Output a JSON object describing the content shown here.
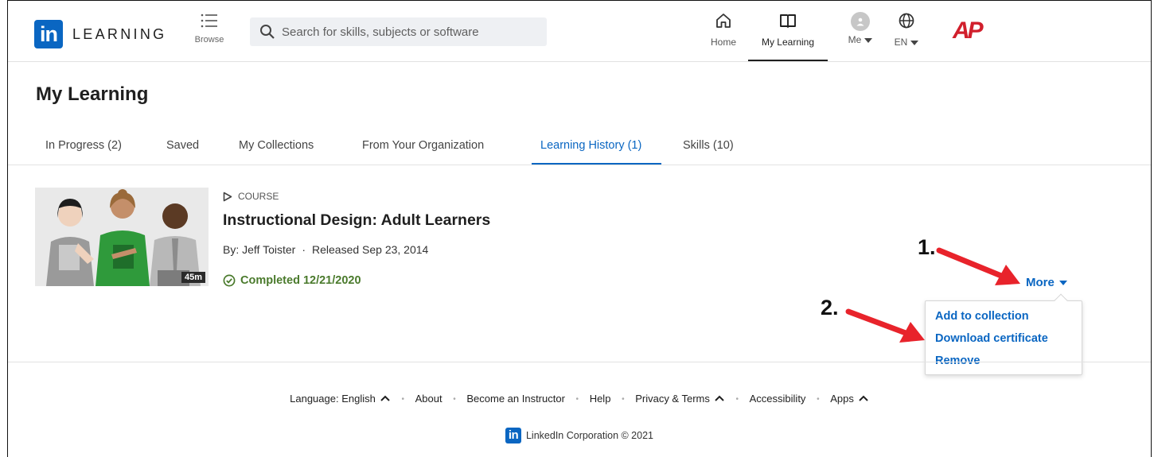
{
  "app": {
    "logo_mark": "in",
    "logo_text": "LEARNING",
    "browse_label": "Browse",
    "search_placeholder": "Search for skills, subjects or software",
    "nav": {
      "home": "Home",
      "my_learning": "My Learning",
      "me": "Me",
      "language": "EN"
    },
    "org_logo": "AP"
  },
  "page": {
    "title": "My Learning",
    "tabs": [
      {
        "label": "In Progress (2)"
      },
      {
        "label": "Saved"
      },
      {
        "label": "My Collections"
      },
      {
        "label": "From Your Organization"
      },
      {
        "label": "Learning History (1)",
        "active": true
      },
      {
        "label": "Skills (10)"
      }
    ]
  },
  "course": {
    "type": "COURSE",
    "title": "Instructional Design: Adult Learners",
    "author": "By: Jeff Toister",
    "released": "Released Sep 23, 2014",
    "separator": "·",
    "duration": "45m",
    "completed": "Completed 12/21/2020"
  },
  "more_menu": {
    "label": "More",
    "items": [
      {
        "label": "Add to collection"
      },
      {
        "label": "Download certificate"
      },
      {
        "label": "Remove"
      }
    ]
  },
  "annotations": {
    "step1": "1.",
    "step2": "2."
  },
  "footer": {
    "links": [
      {
        "label": "Language: English",
        "expandable": true
      },
      {
        "label": "About"
      },
      {
        "label": "Become an Instructor"
      },
      {
        "label": "Help"
      },
      {
        "label": "Privacy & Terms",
        "expandable": true
      },
      {
        "label": "Accessibility"
      },
      {
        "label": "Apps",
        "expandable": true
      }
    ],
    "copyright": "LinkedIn Corporation © 2021"
  },
  "colors": {
    "brand_blue": "#0a66c2",
    "completed_green": "#4a7a2c",
    "annotation_red": "#e8232b",
    "org_red": "#d11f2c"
  }
}
